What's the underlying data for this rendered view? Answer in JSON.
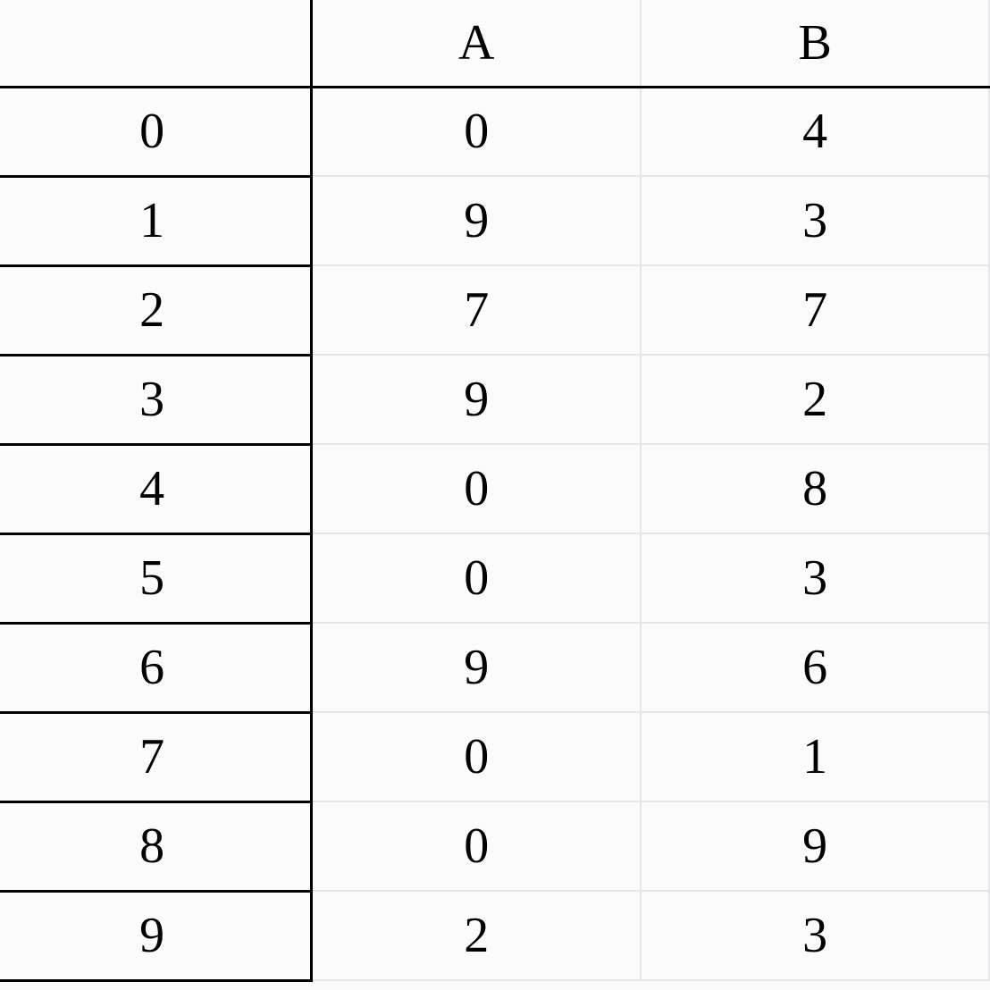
{
  "chart_data": {
    "type": "table",
    "columns": [
      "",
      "A",
      "B"
    ],
    "index": [
      0,
      1,
      2,
      3,
      4,
      5,
      6,
      7,
      8,
      9
    ],
    "series": [
      {
        "name": "A",
        "values": [
          0,
          9,
          7,
          9,
          0,
          0,
          9,
          0,
          0,
          2
        ]
      },
      {
        "name": "B",
        "values": [
          4,
          3,
          7,
          2,
          8,
          3,
          6,
          1,
          9,
          3
        ]
      }
    ]
  },
  "table": {
    "head": {
      "index": "",
      "a": "A",
      "b": "B"
    },
    "rows": [
      {
        "i": "0",
        "a": "0",
        "b": "4"
      },
      {
        "i": "1",
        "a": "9",
        "b": "3"
      },
      {
        "i": "2",
        "a": "7",
        "b": "7"
      },
      {
        "i": "3",
        "a": "9",
        "b": "2"
      },
      {
        "i": "4",
        "a": "0",
        "b": "8"
      },
      {
        "i": "5",
        "a": "0",
        "b": "3"
      },
      {
        "i": "6",
        "a": "9",
        "b": "6"
      },
      {
        "i": "7",
        "a": "0",
        "b": "1"
      },
      {
        "i": "8",
        "a": "0",
        "b": "9"
      },
      {
        "i": "9",
        "a": "2",
        "b": "3"
      }
    ]
  }
}
